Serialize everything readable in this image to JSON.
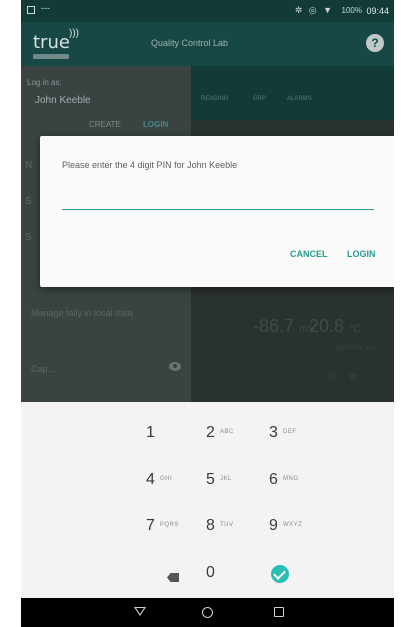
{
  "statusbar": {
    "dash": "---",
    "icons": "✲ ◎ ▼",
    "battery": "100%",
    "time": "09:44"
  },
  "appbar": {
    "logo_text": "true",
    "logo_waves": ")))",
    "title": "Quality Control Lab",
    "help": "?"
  },
  "login_panel": {
    "label": "Log in as:",
    "user": "John Keeble",
    "create": "CREATE",
    "login": "LOGIN"
  },
  "tabs": [
    "READING",
    "GRP",
    "ALARMS"
  ],
  "background_rows": {
    "row1_letter": "N",
    "row2_letter": "S",
    "row3_letter": "S",
    "row4": "Manage tally in local data",
    "cap": "Cap..."
  },
  "readings": {
    "mv": "-86.7",
    "mv_unit": "mV",
    "temp": "20.8",
    "temp_unit": "°C",
    "battery": "BATTERY 96%"
  },
  "dialog": {
    "message": "Please enter the 4 digit PIN for John Keeble",
    "pin_value": "",
    "cancel": "CANCEL",
    "login": "LOGIN",
    "accent": "#2a9b92"
  },
  "keypad": {
    "keys": [
      {
        "num": "1",
        "sub": ""
      },
      {
        "num": "2",
        "sub": "ABC"
      },
      {
        "num": "3",
        "sub": "DEF"
      },
      {
        "num": "4",
        "sub": "GHI"
      },
      {
        "num": "5",
        "sub": "JKL"
      },
      {
        "num": "6",
        "sub": "MNO"
      },
      {
        "num": "7",
        "sub": "PQRS"
      },
      {
        "num": "8",
        "sub": "TUV"
      },
      {
        "num": "9",
        "sub": "WXYZ"
      },
      {
        "num": "0",
        "sub": ""
      }
    ]
  }
}
